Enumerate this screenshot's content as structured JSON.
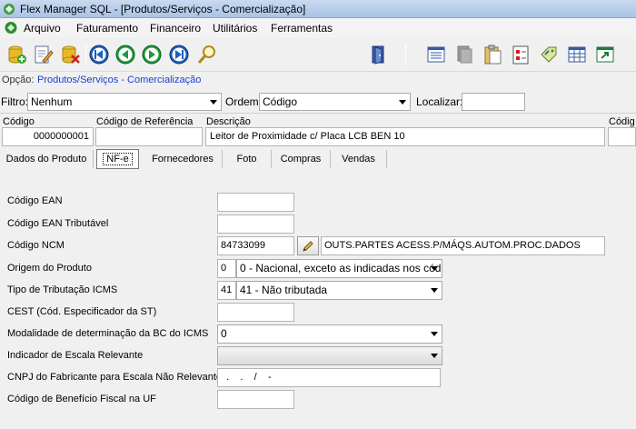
{
  "window": {
    "title": "Flex Manager SQL - [Produtos/Serviços  -  Comercialização]"
  },
  "menu": {
    "items": [
      "Arquivo",
      "Faturamento",
      "Financeiro",
      "Utilitários",
      "Ferramentas"
    ]
  },
  "toolbar": {
    "left_icons": [
      "new-record-icon",
      "edit-record-icon",
      "delete-record-icon",
      "first-record-icon",
      "previous-record-icon",
      "next-record-icon",
      "last-record-icon",
      "search-icon"
    ],
    "right_icons": [
      "exit-door-icon",
      "list-view-icon",
      "disabled-copy-icon",
      "clipboard-icon",
      "checklist-icon",
      "tag-icon",
      "spreadsheet-icon",
      "export-icon"
    ]
  },
  "option": {
    "label": "Opção:",
    "value": "Produtos/Serviços  -  Comercialização"
  },
  "filter": {
    "filter_label": "Filtro:",
    "filter_value": "Nenhum",
    "order_label": "Ordem:",
    "order_value": "Código",
    "locate_label": "Localizar:",
    "locate_value": ""
  },
  "header": {
    "codigo_label": "Código",
    "codigo_value": "0000000001",
    "ref_label": "Código de Referência",
    "ref_value": "",
    "desc_label": "Descrição",
    "desc_value": "Leitor de Proximidade c/ Placa LCB BEN 10",
    "extra_label": "Códig"
  },
  "tabs": [
    {
      "label": "Dados do Produto",
      "active": false
    },
    {
      "label": "NF-e",
      "active": true
    },
    {
      "label": "Fornecedores",
      "active": false
    },
    {
      "label": "Foto",
      "active": false
    },
    {
      "label": "Compras",
      "active": false
    },
    {
      "label": "Vendas",
      "active": false
    }
  ],
  "form": {
    "ean_label": "Código EAN",
    "ean_value": "",
    "ean_trib_label": "Código EAN Tributável",
    "ean_trib_value": "",
    "ncm_label": "Código NCM",
    "ncm_value": "84733099",
    "ncm_desc": "OUTS.PARTES ACESS.P/MÁQS.AUTOM.PROC.DADOS",
    "origem_label": "Origem do Produto",
    "origem_code": "0",
    "origem_value": "0 - Nacional, exceto as indicadas nos cód",
    "icms_label": "Tipo de Tributação ICMS",
    "icms_code": "41",
    "icms_value": "41 - Não tributada",
    "cest_label": "CEST (Cód. Especificador da ST)",
    "cest_value": "",
    "bc_label": "Modalidade de determinação da BC do ICMS",
    "bc_value": "0",
    "escala_label": "Indicador de Escala Relevante",
    "escala_value": "",
    "cnpj_label": "CNPJ do Fabricante para Escala Não Relevante",
    "cnpj_value": "  .    .    /    -",
    "beneficio_label": "Código de Benefício Fiscal na UF",
    "beneficio_value": ""
  }
}
